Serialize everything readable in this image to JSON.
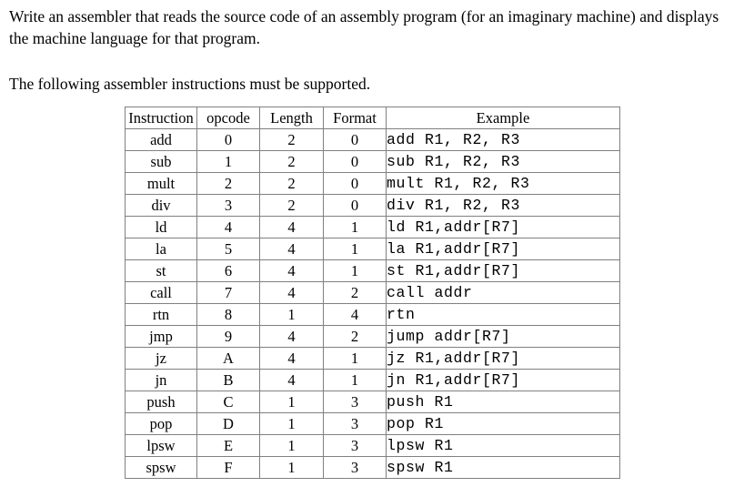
{
  "intro": {
    "paragraph1": "Write an assembler that reads the source code of an assembly program (for an imaginary machine) and displays the machine language for that program.",
    "paragraph2": "The following assembler instructions must be supported."
  },
  "table": {
    "headers": {
      "instruction": "Instruction",
      "opcode": "opcode",
      "length": "Length",
      "format": "Format",
      "example": "Example"
    },
    "rows": [
      {
        "instruction": "add",
        "opcode": "0",
        "length": "2",
        "format": "0",
        "example": "add   R1,  R2,  R3"
      },
      {
        "instruction": "sub",
        "opcode": "1",
        "length": "2",
        "format": "0",
        "example": "sub   R1,  R2,  R3"
      },
      {
        "instruction": "mult",
        "opcode": "2",
        "length": "2",
        "format": "0",
        "example": "mult  R1,  R2,  R3"
      },
      {
        "instruction": "div",
        "opcode": "3",
        "length": "2",
        "format": "0",
        "example": "div   R1,  R2,  R3"
      },
      {
        "instruction": "ld",
        "opcode": "4",
        "length": "4",
        "format": "1",
        "example": "ld    R1,addr[R7]"
      },
      {
        "instruction": "la",
        "opcode": "5",
        "length": "4",
        "format": "1",
        "example": "la    R1,addr[R7]"
      },
      {
        "instruction": "st",
        "opcode": "6",
        "length": "4",
        "format": "1",
        "example": "st    R1,addr[R7]"
      },
      {
        "instruction": "call",
        "opcode": "7",
        "length": "4",
        "format": "2",
        "example": "call addr"
      },
      {
        "instruction": "rtn",
        "opcode": "8",
        "length": "1",
        "format": "4",
        "example": "rtn"
      },
      {
        "instruction": "jmp",
        "opcode": "9",
        "length": "4",
        "format": "2",
        "example": "jump addr[R7]"
      },
      {
        "instruction": "jz",
        "opcode": "A",
        "length": "4",
        "format": "1",
        "example": "jz    R1,addr[R7]"
      },
      {
        "instruction": "jn",
        "opcode": "B",
        "length": "4",
        "format": "1",
        "example": "jn    R1,addr[R7]"
      },
      {
        "instruction": "push",
        "opcode": "C",
        "length": "1",
        "format": "3",
        "example": "push R1"
      },
      {
        "instruction": "pop",
        "opcode": "D",
        "length": "1",
        "format": "3",
        "example": "pop  R1"
      },
      {
        "instruction": "lpsw",
        "opcode": "E",
        "length": "1",
        "format": "3",
        "example": "lpsw R1"
      },
      {
        "instruction": "spsw",
        "opcode": "F",
        "length": "1",
        "format": "3",
        "example": "spsw R1"
      }
    ]
  }
}
